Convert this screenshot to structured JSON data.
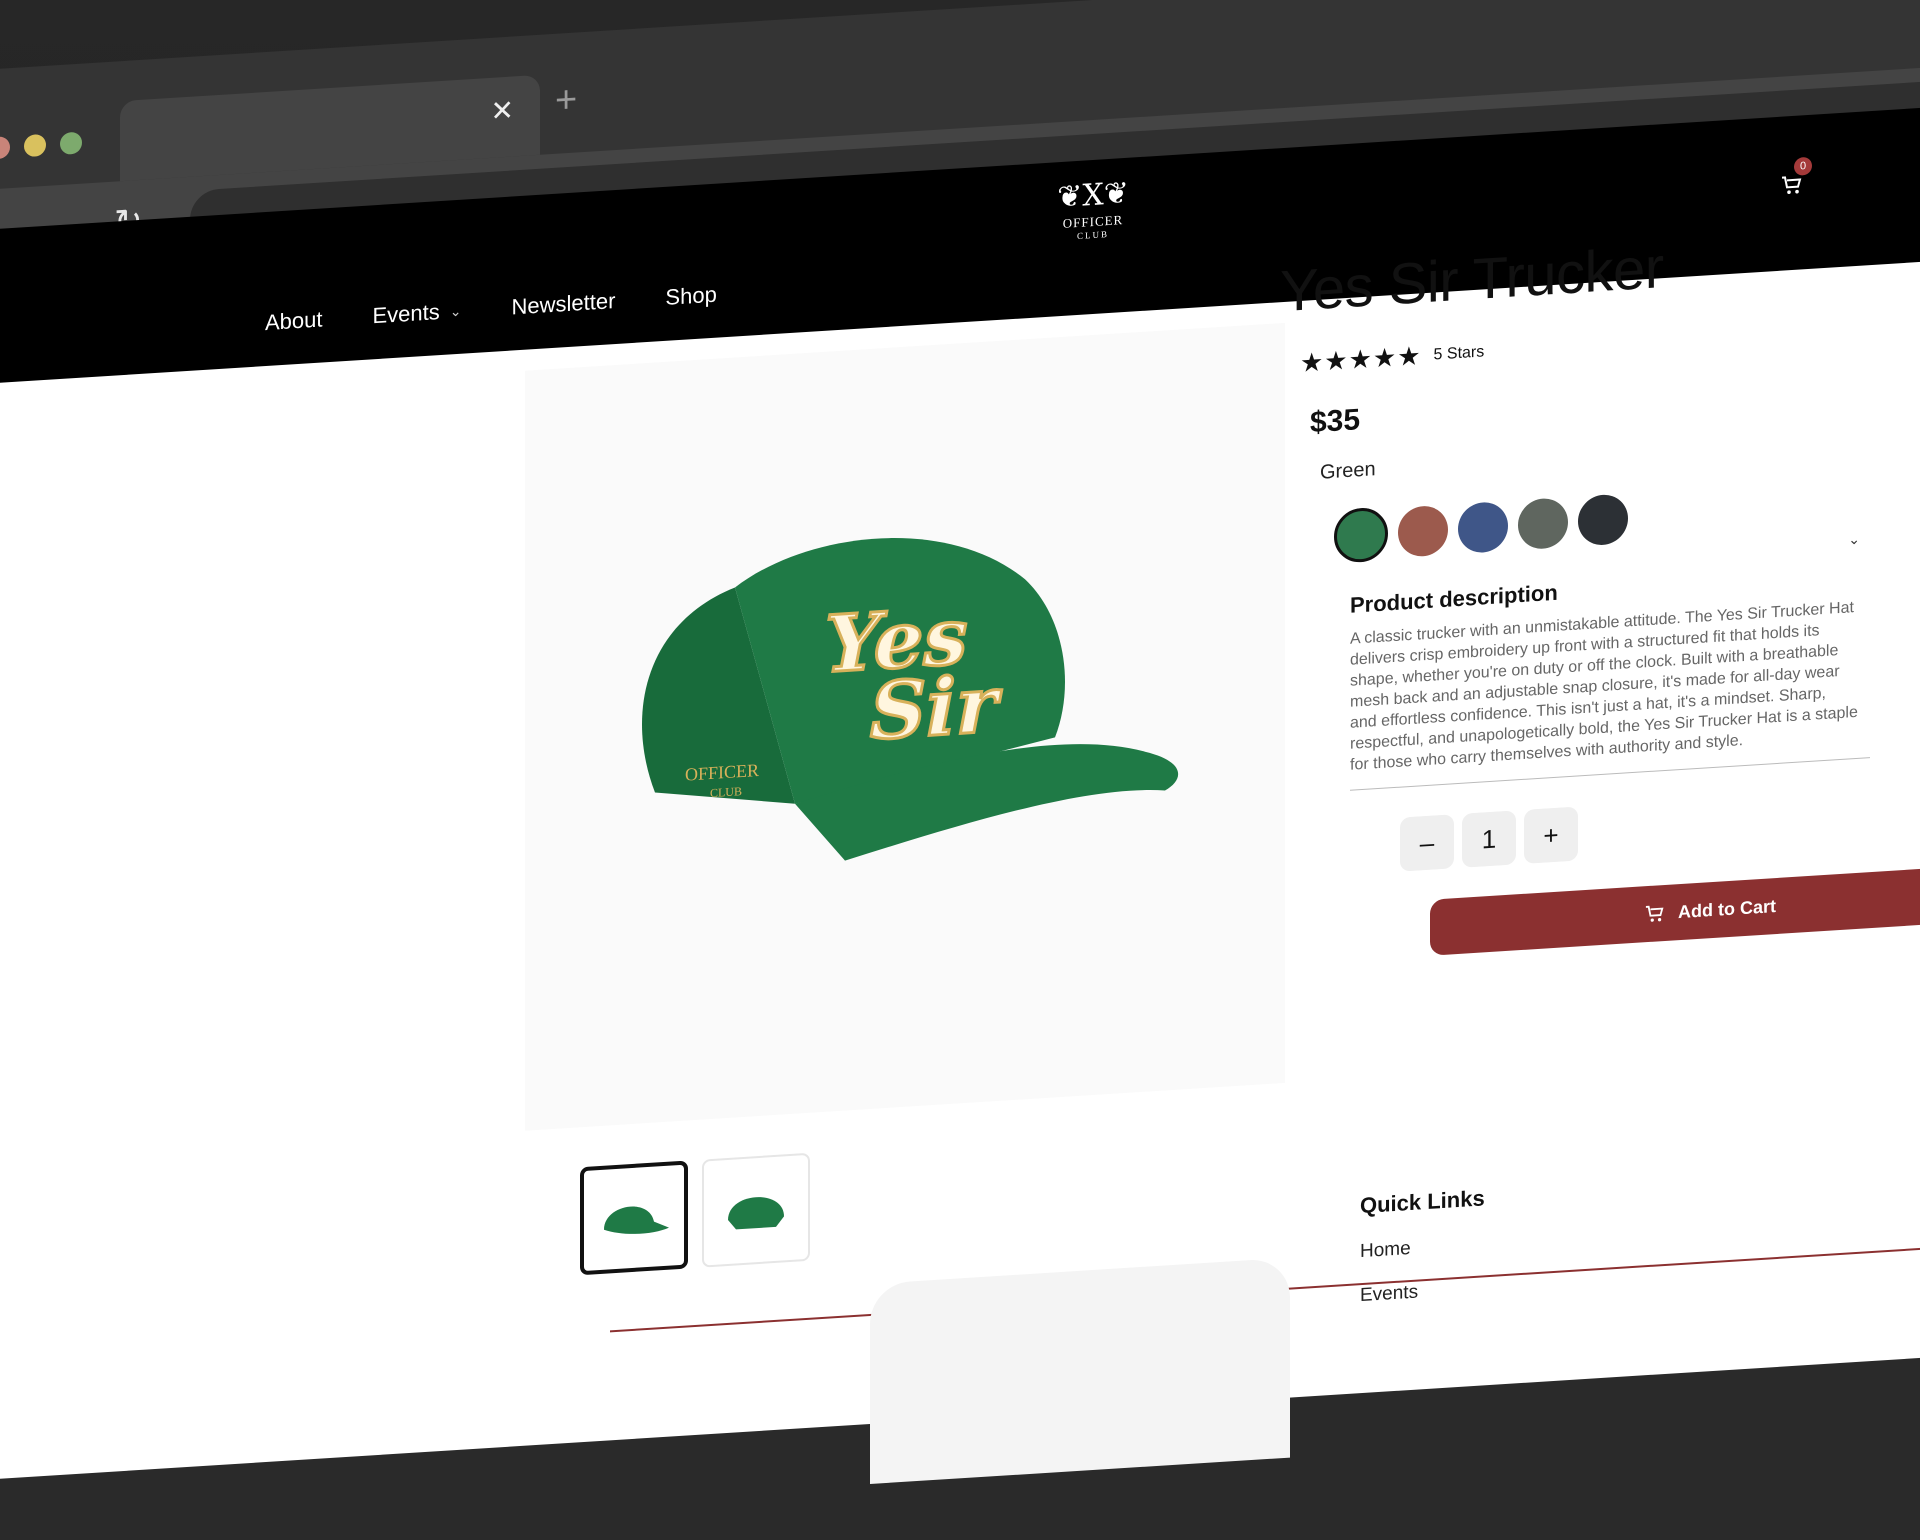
{
  "browser": {
    "traffic_colors": [
      "#c98479",
      "#d9c15e",
      "#7daa6d"
    ],
    "tab_close": "✕",
    "new_tab": "+",
    "nav": {
      "back": "←",
      "forward": "→",
      "reload": "↻"
    }
  },
  "site": {
    "menu": [
      {
        "label": "About"
      },
      {
        "label": "Events",
        "chevron": "⌄"
      },
      {
        "label": "Newsletter"
      },
      {
        "label": "Shop"
      }
    ],
    "logo": {
      "mark": "X",
      "line1": "OFFICER",
      "line2": "CLUB"
    },
    "cart": {
      "icon": "cart-icon",
      "count": "0"
    }
  },
  "product": {
    "title": "Yes Sir Trucker",
    "stars": "★★★★★",
    "rating_label": "5 Stars",
    "price": "$35",
    "color": "Green",
    "swatches": [
      "#2f7a4e",
      "#9c5a4d",
      "#3f5688",
      "#5f665f",
      "#2c3035"
    ],
    "selected_swatch": 0,
    "description_title": "Product description",
    "description": "A classic trucker with an unmistakable attitude. The Yes Sir Trucker Hat delivers crisp embroidery up front with a structured fit that holds its shape, whether you're on duty or off the clock. Built with a breathable mesh back and an adjustable snap closure, it's made for all-day wear and effortless confidence. This isn't just a hat, it's a mindset. Sharp, respectful, and unapologetically bold, the Yes Sir Trucker Hat is a staple for those who carry themselves with authority and style.",
    "quantity": "1",
    "minus": "–",
    "plus": "+",
    "add_to_cart": "Add to Cart",
    "hat_colors": {
      "body": "#1f7a46",
      "mesh": "#186b3b",
      "text": "#fff6df",
      "shadow": "#d8b15a"
    },
    "hat_patch": {
      "line1": "OFFICER",
      "line2": "CLUB"
    },
    "hat_text": {
      "line1": "Yes",
      "line2": "Sir"
    }
  },
  "footer": {
    "quick_links_title": "Quick Links",
    "links": [
      "Home",
      "Events"
    ]
  }
}
